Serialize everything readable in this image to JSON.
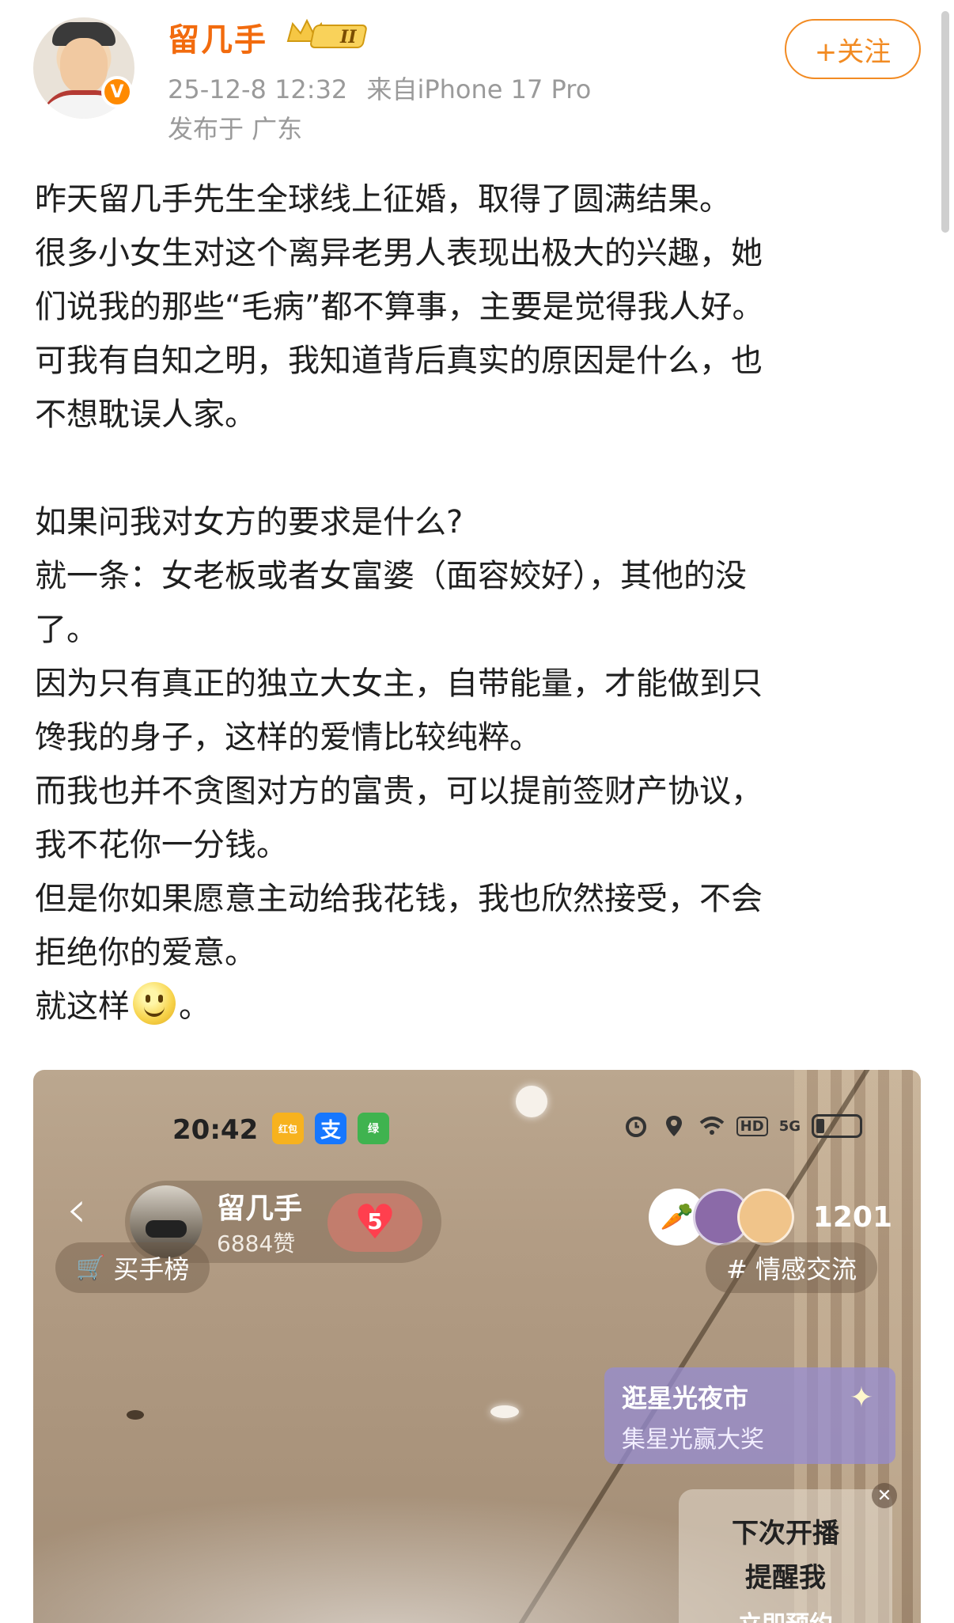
{
  "author": {
    "name": "留几手",
    "level_badge": "II",
    "verified_mark": "V",
    "timestamp": "25-12-8 12:32",
    "source": "来自iPhone 17 Pro",
    "location": "发布于 广东"
  },
  "follow_button": {
    "label": "+关注"
  },
  "post": {
    "lines": [
      "昨天留几手先生全球线上征婚，取得了圆满结果。",
      "很多小女生对这个离异老男人表现出极大的兴趣，她",
      "们说我的那些“毛病”都不算事，主要是觉得我人好。",
      "可我有自知之明，我知道背后真实的原因是什么，也",
      "不想耽误人家。",
      "",
      "如果问我对女方的要求是什么?",
      "就一条：女老板或者女富婆（面容姣好），其他的没",
      "了。",
      "因为只有真正的独立大女主，自带能量，才能做到只",
      "馋我的身子，这样的爱情比较纯粹。",
      "而我也并不贪图对方的富贵，可以提前签财产协议，",
      "我不花你一分钱。",
      "但是你如果愿意主动给我花钱，我也欣然接受，不会",
      "拒绝你的爱意。"
    ],
    "last_line_before": "就这样",
    "last_line_after": "。"
  },
  "screenshot": {
    "status_time": "20:42",
    "status_apps": [
      "红包",
      "支",
      "绿"
    ],
    "status_icons": [
      "alarm-icon",
      "location-icon",
      "wifi-icon",
      "HD",
      "5G",
      "battery-icon"
    ],
    "host_name": "留几手",
    "host_likes": "6884赞",
    "heart_level": "5",
    "viewer_count": "1201",
    "buyer_rank": "买手榜",
    "topic_tag": "# 情感交流",
    "promo_title": "逛星光夜市",
    "promo_subtitle": "集星光赢大奖",
    "remind_line1": "下次开播",
    "remind_line2": "提醒我",
    "remind_line3": "立即预约",
    "colors": {
      "accent_orange": "#f26b0e",
      "follow_orange": "#f28b23",
      "heart_red": "#ff3f4e"
    }
  }
}
